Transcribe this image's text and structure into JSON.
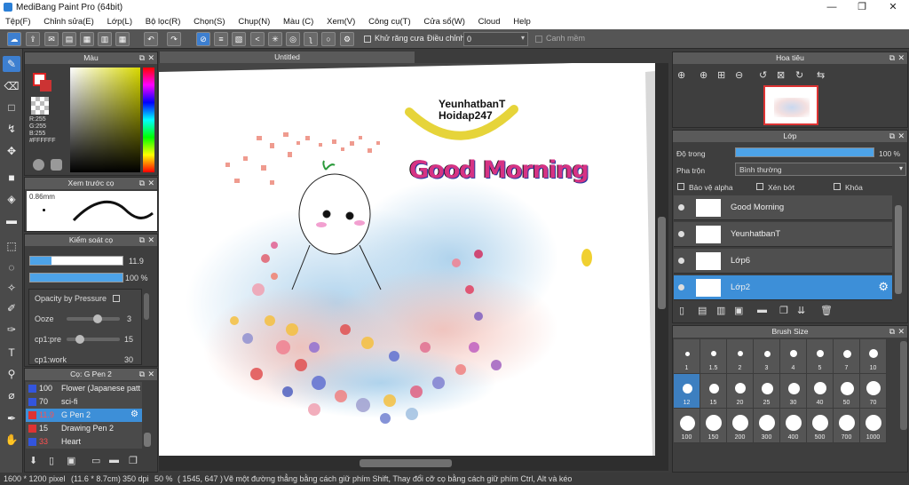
{
  "window": {
    "title": "MediBang Paint Pro (64bit)",
    "minimize": "—",
    "maximize": "❐",
    "close": "✕"
  },
  "menu": [
    "Tệp(F)",
    "Chỉnh sửa(E)",
    "Lớp(L)",
    "Bộ lọc(R)",
    "Chọn(S)",
    "Chụp(N)",
    "Màu (C)",
    "Xem(V)",
    "Công cụ(T)",
    "Cửa sổ(W)",
    "Cloud",
    "Help"
  ],
  "toolbar": {
    "antialias_label": "Khử răng cưa",
    "adjust_label": "Điều chỉnh",
    "adjust_value": "0",
    "smoothing_label": "Canh mềm"
  },
  "color_panel": {
    "title": "Màu",
    "r": "R:255",
    "g": "G:255",
    "b": "B:255",
    "hex": "#FFFFFF"
  },
  "brush_preview_panel": {
    "title": "Xem trước cọ",
    "size": "0.86mm"
  },
  "brush_control_panel": {
    "title": "Kiểm soát cọ",
    "size_value": "11.9",
    "opacity_value": "100 %",
    "opacity_by_pressure": "Opacity by Pressure",
    "ooze_label": "Ooze",
    "ooze_value": "3",
    "cp1_label": "cp1:pre",
    "cp1_value": "15",
    "cp2_label": "cp1:work",
    "cp2_value": "30"
  },
  "brush_list_panel": {
    "title": "Cọ: G Pen 2",
    "items": [
      {
        "size": "100",
        "name": "Flower (Japanese patt",
        "color": "#3355dd",
        "selected": false
      },
      {
        "size": "70",
        "name": "sci-fi",
        "color": "#3355dd",
        "selected": false
      },
      {
        "size": "11.9",
        "name": "G Pen 2",
        "color": "#dd3333",
        "selected": true
      },
      {
        "size": "15",
        "name": "Drawing Pen 2",
        "color": "#dd3333",
        "selected": false
      },
      {
        "size": "33",
        "name": "Heart",
        "color": "#3355dd",
        "selected": false
      }
    ]
  },
  "canvas": {
    "tab": "Untitled",
    "text_brand1": "YeunhatbanT",
    "text_brand2": "Hoidap247",
    "text_title": "Good Morning"
  },
  "navigator_panel": {
    "title": "Hoa tiêu"
  },
  "layer_panel": {
    "title": "Lớp",
    "opacity_label": "Độ trong",
    "opacity_value": "100 %",
    "blend_label": "Pha trộn",
    "blend_value": "Bình thường",
    "protect_alpha": "Bảo vệ alpha",
    "clipping": "Xén bớt",
    "lock": "Khóa",
    "layers": [
      {
        "name": "Good Morning",
        "selected": false
      },
      {
        "name": "YeunhatbanT",
        "selected": false
      },
      {
        "name": "Lớp6",
        "selected": false
      },
      {
        "name": "Lớp2",
        "selected": true
      }
    ]
  },
  "brush_size_panel": {
    "title": "Brush Size",
    "sizes": [
      "1",
      "1.5",
      "2",
      "3",
      "4",
      "5",
      "7",
      "10",
      "12",
      "15",
      "20",
      "25",
      "30",
      "40",
      "50",
      "70",
      "100",
      "150",
      "200",
      "300",
      "400",
      "500",
      "700",
      "1000"
    ]
  },
  "status": {
    "dimensions": "1600 * 1200 pixel",
    "physical": "(11.6 * 8.7cm)",
    "dpi": "350 dpi",
    "zoom": "50 %",
    "coords": "( 1545, 647 )",
    "hint": "Vẽ một đường thẳng bằng cách giữ phím Shift, Thay đổi cỡ cọ bằng cách giữ phím Ctrl, Alt và kéo"
  }
}
